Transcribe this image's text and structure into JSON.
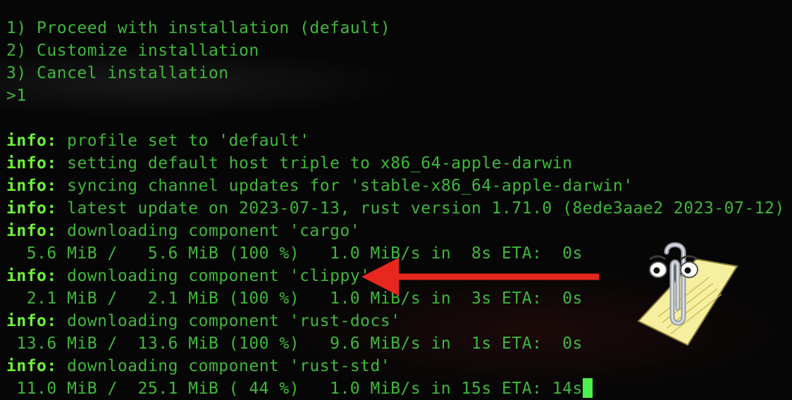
{
  "terminal": {
    "menu": [
      "1) Proceed with installation (default)",
      "2) Customize installation",
      "3) Cancel installation"
    ],
    "prompt_input": ">1",
    "info_prefix": "info:",
    "log": [
      {
        "type": "info",
        "text": " profile set to 'default'"
      },
      {
        "type": "info",
        "text": " setting default host triple to x86_64-apple-darwin"
      },
      {
        "type": "info",
        "text": " syncing channel updates for 'stable-x86_64-apple-darwin'"
      },
      {
        "type": "info",
        "text": " latest update on 2023-07-13, rust version 1.71.0 (8ede3aae2 2023-07-12)"
      },
      {
        "type": "info",
        "text": " downloading component 'cargo'"
      },
      {
        "type": "progress",
        "text": "  5.6 MiB /   5.6 MiB (100 %)   1.0 MiB/s in  8s ETA:  0s"
      },
      {
        "type": "info",
        "text": " downloading component 'clippy'"
      },
      {
        "type": "progress",
        "text": "  2.1 MiB /   2.1 MiB (100 %)   1.0 MiB/s in  3s ETA:  0s"
      },
      {
        "type": "info",
        "text": " downloading component 'rust-docs'"
      },
      {
        "type": "progress",
        "text": " 13.6 MiB /  13.6 MiB (100 %)   9.6 MiB/s in  1s ETA:  0s"
      },
      {
        "type": "info",
        "text": " downloading component 'rust-std'"
      },
      {
        "type": "progress",
        "text": " 11.0 MiB /  25.1 MiB ( 44 %)   1.0 MiB/s in 15s ETA: 14s",
        "cursor": true
      }
    ]
  },
  "colors": {
    "background": "#060606",
    "text": "#3fb83a",
    "prefix": "#6df23a",
    "cursor": "#4cf04c",
    "arrow": "#e8281e"
  },
  "overlay": {
    "arrow_target": "clippy",
    "mascot_icon": "clippy-paperclip-icon"
  }
}
